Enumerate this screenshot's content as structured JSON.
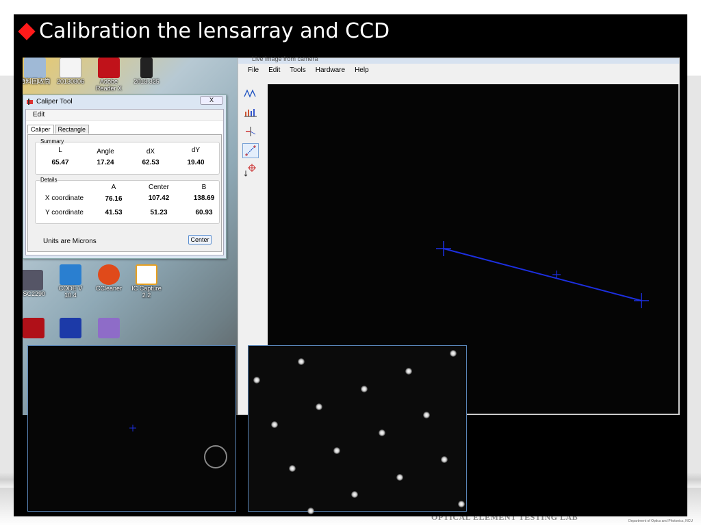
{
  "slide": {
    "title": "Calibration the lensarray and CCD",
    "footer_lab": "OPTICAL ELEMENT TESTING LAB",
    "footer_dept": "Department of Optics and Photonics, NCU"
  },
  "desktop": {
    "icons": [
      {
        "label": "資料回收筒",
        "icon": "recycle-bin-icon"
      },
      {
        "label": "20130806",
        "icon": "powerpoint-file-icon"
      },
      {
        "label": "Adobe Reader X",
        "icon": "adobe-reader-icon"
      },
      {
        "label": "2013.325",
        "icon": "folder-icon"
      },
      {
        "label": "FSC2290",
        "icon": "camera-app-icon"
      },
      {
        "label": "CODE V 10.4",
        "icon": "codev-icon"
      },
      {
        "label": "CCleaner",
        "icon": "ccleaner-icon"
      },
      {
        "label": "IC Capture 2.2",
        "icon": "ic-capture-icon"
      },
      {
        "label": "",
        "icon": "mcafee-icon"
      },
      {
        "label": "",
        "icon": "codev-app-icon"
      },
      {
        "label": "",
        "icon": "visual-studio-icon"
      }
    ]
  },
  "caliper": {
    "title": "Caliper Tool",
    "close_label": "X",
    "menu_edit": "Edit",
    "tabs": [
      "Caliper",
      "Rectangle"
    ],
    "summary_label": "Summary",
    "summary_headers": [
      "L",
      "Angle",
      "dX",
      "dY"
    ],
    "summary_values": [
      "65.47",
      "17.24",
      "62.53",
      "19.40"
    ],
    "details_label": "Details",
    "details_headers": [
      "A",
      "Center",
      "B"
    ],
    "x_label": "X coordinate",
    "x_values": [
      "76.16",
      "107.42",
      "138.69"
    ],
    "y_label": "Y coordinate",
    "y_values": [
      "41.53",
      "51.23",
      "60.93"
    ],
    "units": "Units are Microns",
    "center_button": "Center"
  },
  "live": {
    "title": "Live image from camera",
    "menu": [
      "File",
      "Edit",
      "Tools",
      "Hardware",
      "Help"
    ],
    "tools": [
      "profile-icon",
      "histogram-icon",
      "marker-icon",
      "caliper-icon",
      "crosshair-icon"
    ],
    "line_color": "#1c2fe0"
  }
}
